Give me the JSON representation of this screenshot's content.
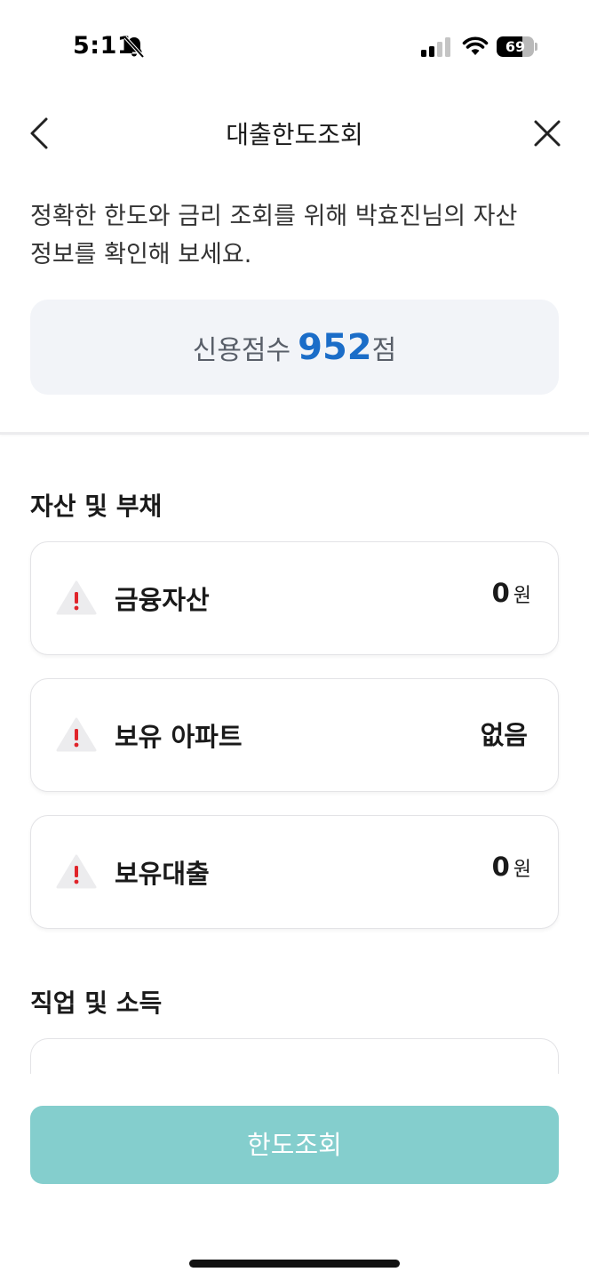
{
  "status_bar": {
    "time": "5:11",
    "battery_level": "69",
    "icons": [
      "bell-off-icon",
      "signal-icon",
      "wifi-icon",
      "battery-icon"
    ]
  },
  "nav": {
    "title": "대출한도조회",
    "back_icon": "chevron-left-icon",
    "close_icon": "close-icon"
  },
  "intro": {
    "line1": "정확한 한도와 금리 조회를 위해 박효진님의 자산",
    "line2": "정보를 확인해 보세요."
  },
  "credit": {
    "label": "신용점수",
    "score": "952",
    "unit": "점"
  },
  "assets_section": {
    "title": "자산 및 부채",
    "items": [
      {
        "label": "금융자산",
        "value": "0",
        "unit": "원",
        "icon": "warning-icon"
      },
      {
        "label": "보유 아파트",
        "value": "없음",
        "unit": "",
        "icon": "warning-icon"
      },
      {
        "label": "보유대출",
        "value": "0",
        "unit": "원",
        "icon": "warning-icon"
      }
    ]
  },
  "job_section": {
    "title": "직업 및 소득"
  },
  "submit": {
    "label": "한도조회"
  },
  "colors": {
    "accent_blue": "#1b6dc8",
    "button_teal": "#84cecd",
    "warning_red": "#e0242a",
    "card_gray": "#f2f4f8"
  }
}
